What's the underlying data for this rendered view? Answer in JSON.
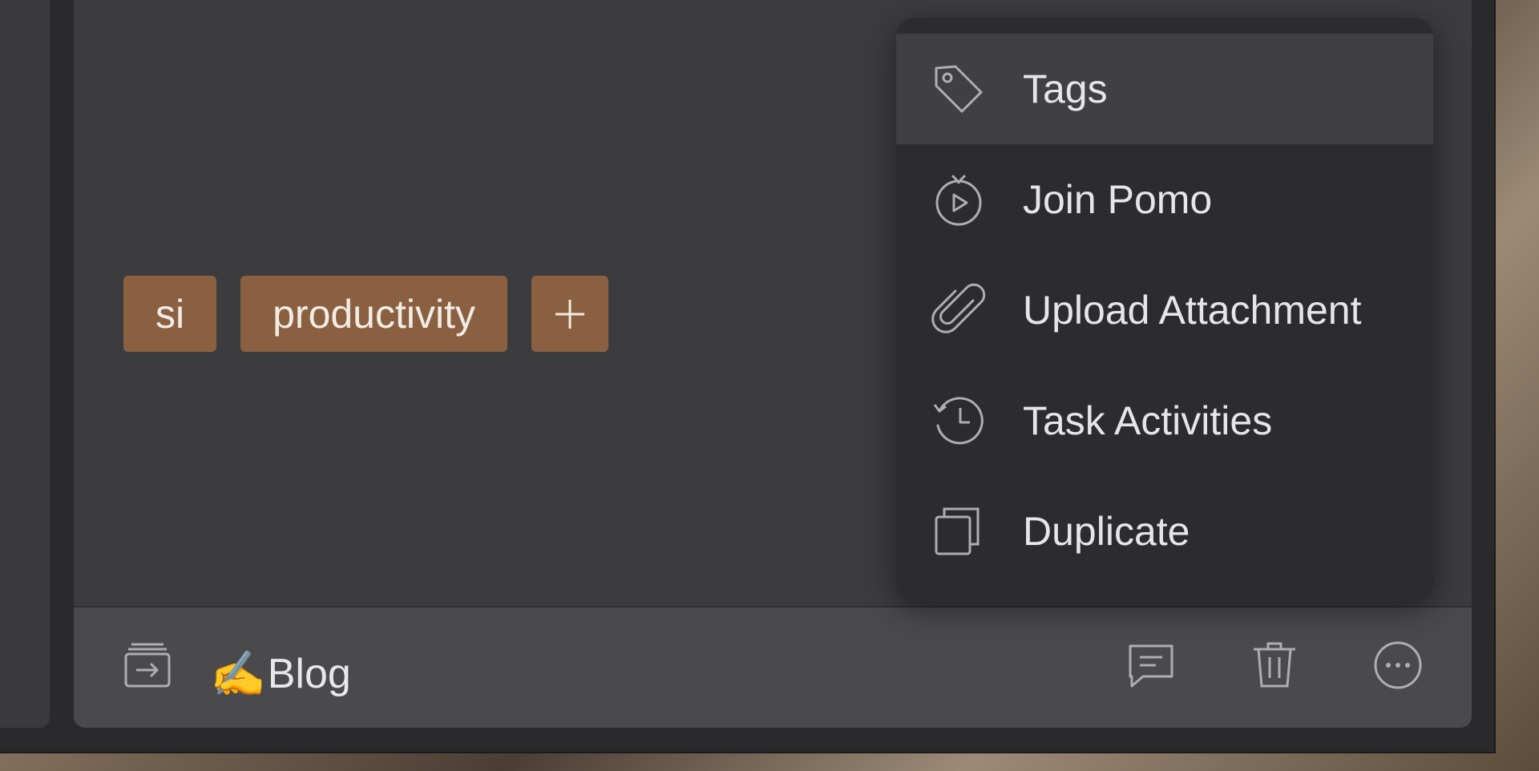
{
  "tags": [
    {
      "label": "si"
    },
    {
      "label": "productivity"
    }
  ],
  "add_tag_icon": "plus-icon",
  "bottom_bar": {
    "list_emoji": "✍️",
    "list_label": "Blog",
    "icons": [
      "move-to-list-icon",
      "comment-icon",
      "trash-icon",
      "more-icon"
    ]
  },
  "menu": {
    "items": [
      {
        "label": "Tags",
        "icon": "tag-icon"
      },
      {
        "label": "Join Pomo",
        "icon": "pomo-timer-icon"
      },
      {
        "label": "Upload Attachment",
        "icon": "paperclip-icon"
      },
      {
        "label": "Task Activities",
        "icon": "history-icon"
      },
      {
        "label": "Duplicate",
        "icon": "duplicate-icon"
      }
    ]
  },
  "colors": {
    "tag_bg": "#8a6040",
    "menu_bg": "#2c2c2f",
    "menu_highlight": "#404043",
    "pane_bg": "#3c3c3f"
  }
}
